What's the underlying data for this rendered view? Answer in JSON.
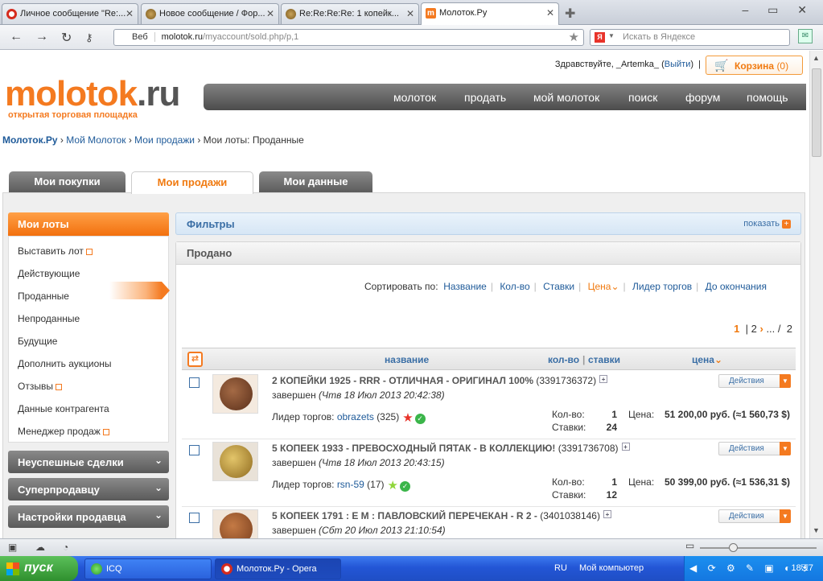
{
  "browser": {
    "tabs": [
      {
        "title": "Личное сообщение \"Re:...",
        "icon": "coin-favicon"
      },
      {
        "title": "Новое сообщение / Фор...",
        "icon": "coin-favicon"
      },
      {
        "title": "Re:Re:Re:Re: 1 копейк...",
        "icon": "coin-favicon"
      },
      {
        "title": "Молоток.Ру",
        "icon": "molotok-favicon"
      }
    ],
    "address": {
      "scheme_label": "Веб",
      "host": "molotok.ru",
      "path": "/myaccount/sold.php/p,1"
    },
    "search_placeholder": "Искать в Яндексе"
  },
  "header": {
    "greeting": "Здравствуйте, _Artemka_",
    "logout_label": "Выйти",
    "cart_label": "Корзина",
    "cart_count": "(0)",
    "logo_main": "molotok",
    "logo_tld": ".ru",
    "tagline": "открытая торговая площадка",
    "nav": [
      "молоток",
      "продать",
      "мой молоток",
      "поиск",
      "форум",
      "помощь"
    ]
  },
  "breadcrumb": {
    "items": [
      "Молоток.Ру",
      "Мой Молоток",
      "Мои продажи"
    ],
    "current": "Мои лоты: Проданные"
  },
  "page_tabs": [
    "Мои покупки",
    "Мои продажи",
    "Мои данные"
  ],
  "sidebar": {
    "header": "Мои лоты",
    "items": [
      {
        "label": "Выставить лот",
        "rss": true
      },
      {
        "label": "Действующие"
      },
      {
        "label": "Проданные",
        "active": true
      },
      {
        "label": "Непроданные"
      },
      {
        "label": "Будущие"
      },
      {
        "label": "Дополнить аукционы"
      },
      {
        "label": "Отзывы",
        "rss": true
      },
      {
        "label": "Данные контрагента"
      },
      {
        "label": "Менеджер продаж",
        "rss": true
      }
    ],
    "groups": [
      "Неуспешные сделки",
      "Суперпродавцу",
      "Настройки продавца"
    ]
  },
  "filters": {
    "title": "Фильтры",
    "show_label": "показать"
  },
  "sold": {
    "title": "Продано",
    "sort_label": "Сортировать по:",
    "sort_options": [
      "Название",
      "Кол-во",
      "Ставки",
      "Цена",
      "Лидер торгов",
      "До окончания"
    ],
    "pager": {
      "current": "1",
      "next": "2",
      "ellipsis": "...",
      "sep": "/",
      "total": "2"
    },
    "columns": {
      "name": "название",
      "qty": "кол-во",
      "bids": "ставки",
      "price": "цена"
    },
    "labels": {
      "leader": "Лидер торгов:",
      "qty": "Кол-во:",
      "bids": "Ставки:",
      "price": "Цена:",
      "actions": "Действия"
    },
    "rows": [
      {
        "title": "2 КОПЕЙКИ 1925 - RRR - ОТЛИЧНАЯ - ОРИГИНАЛ 100%",
        "id": "(3391736372)",
        "status": "завершен",
        "date": "(Чтв 18 Июл 2013 20:42:38)",
        "leader": "obrazets",
        "rating": "(325)",
        "star_color": "#e8332a",
        "qty": "1",
        "bids": "24",
        "price": "51 200,00 руб. (≈1 560,73 $)"
      },
      {
        "title": "5 КОПЕЕК 1933 - ПРЕВОСХОДНЫЙ ПЯТАК - В КОЛЛЕКЦИЮ!",
        "id": "(3391736708)",
        "status": "завершен",
        "date": "(Чтв 18 Июл 2013 20:43:15)",
        "leader": "rsn-59",
        "rating": "(17)",
        "star_color": "#8fd63a",
        "qty": "1",
        "bids": "12",
        "price": "50 399,00 руб. (≈1 536,31 $)"
      },
      {
        "title": "5 КОПЕЕК 1791 : Е М : ПАВЛОВСКИЙ ПЕРЕЧЕКАН - R 2 -",
        "id": "(3401038146)",
        "status": "завершен",
        "date": "(Сбт 20 Июл 2013 21:10:54)"
      }
    ]
  },
  "taskbar": {
    "start": "пуск",
    "tasks": [
      "ICQ",
      "Молоток.Ру - Opera"
    ],
    "lang": "RU",
    "my_computer": "Мой компьютер",
    "clock": "18:17"
  }
}
